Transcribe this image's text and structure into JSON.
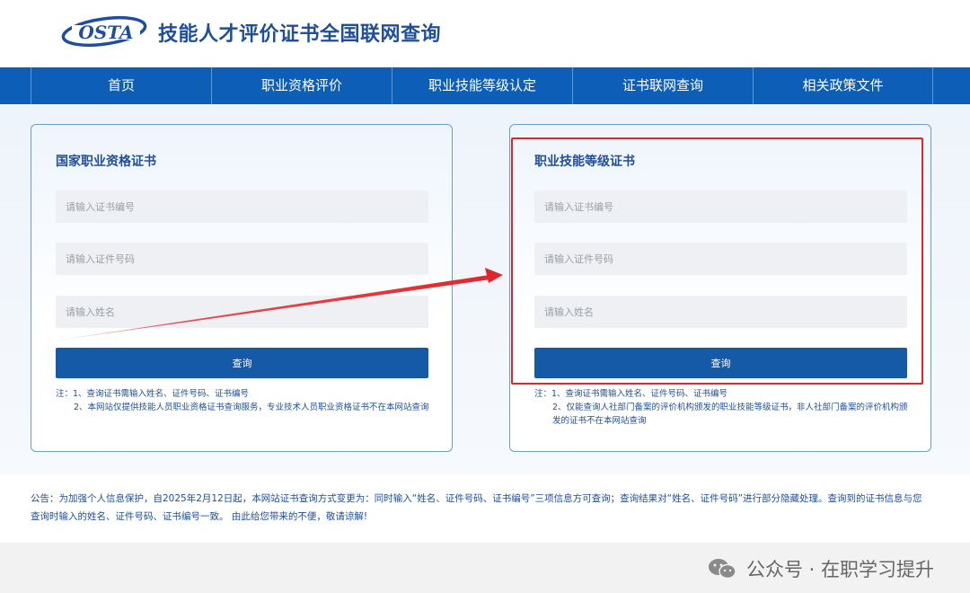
{
  "header": {
    "logo_text": "OSTA",
    "title": "技能人才评价证书全国联网查询"
  },
  "nav": {
    "items": [
      {
        "label": "首页"
      },
      {
        "label": "职业资格评价"
      },
      {
        "label": "职业技能等级认定"
      },
      {
        "label": "证书联网查询"
      },
      {
        "label": "相关政策文件"
      }
    ]
  },
  "cards": [
    {
      "title": "国家职业资格证书",
      "cert_no_placeholder": "请输入证书编号",
      "id_no_placeholder": "请输入证件号码",
      "name_placeholder": "请输入姓名",
      "submit_label": "查询",
      "note_line1": "注：1、查询证书需输入姓名、证件号码、证书编号",
      "note_line2": "2、本网站仅提供技能人员职业资格证书查询服务，专业技术人员职业资格证书不在本网站查询"
    },
    {
      "title": "职业技能等级证书",
      "cert_no_placeholder": "请输入证书编号",
      "id_no_placeholder": "请输入证件号码",
      "name_placeholder": "请输入姓名",
      "submit_label": "查询",
      "note_line1": "注：1、查询证书需输入姓名、证件号码、证书编号",
      "note_line2": "2、仅能查询人社部门备案的评价机构颁发的职业技能等级证书，非人社部门备案的评价机构颁发的证书不在本网站查询"
    }
  ],
  "notice": "公告：为加强个人信息保护，自2025年2月12日起，本网站证书查询方式变更为：同时输入“姓名、证件号码、证书编号”三项信息方可查询；查询结果对“姓名、证件号码”进行部分隐藏处理。查询到的证书信息与您查询时输入的姓名、证件号码、证书编号一致。 由此给您带来的不便，敬请谅解!",
  "watermark": "公众号 · 在职学习提升",
  "colors": {
    "nav_bg": "#0d5eb6",
    "button_bg": "#155aa6",
    "title_blue": "#1f4e9a",
    "highlight_red": "#e0262b"
  },
  "icons": {
    "logo": "osta-logo-icon",
    "watermark": "wechat-icon"
  }
}
